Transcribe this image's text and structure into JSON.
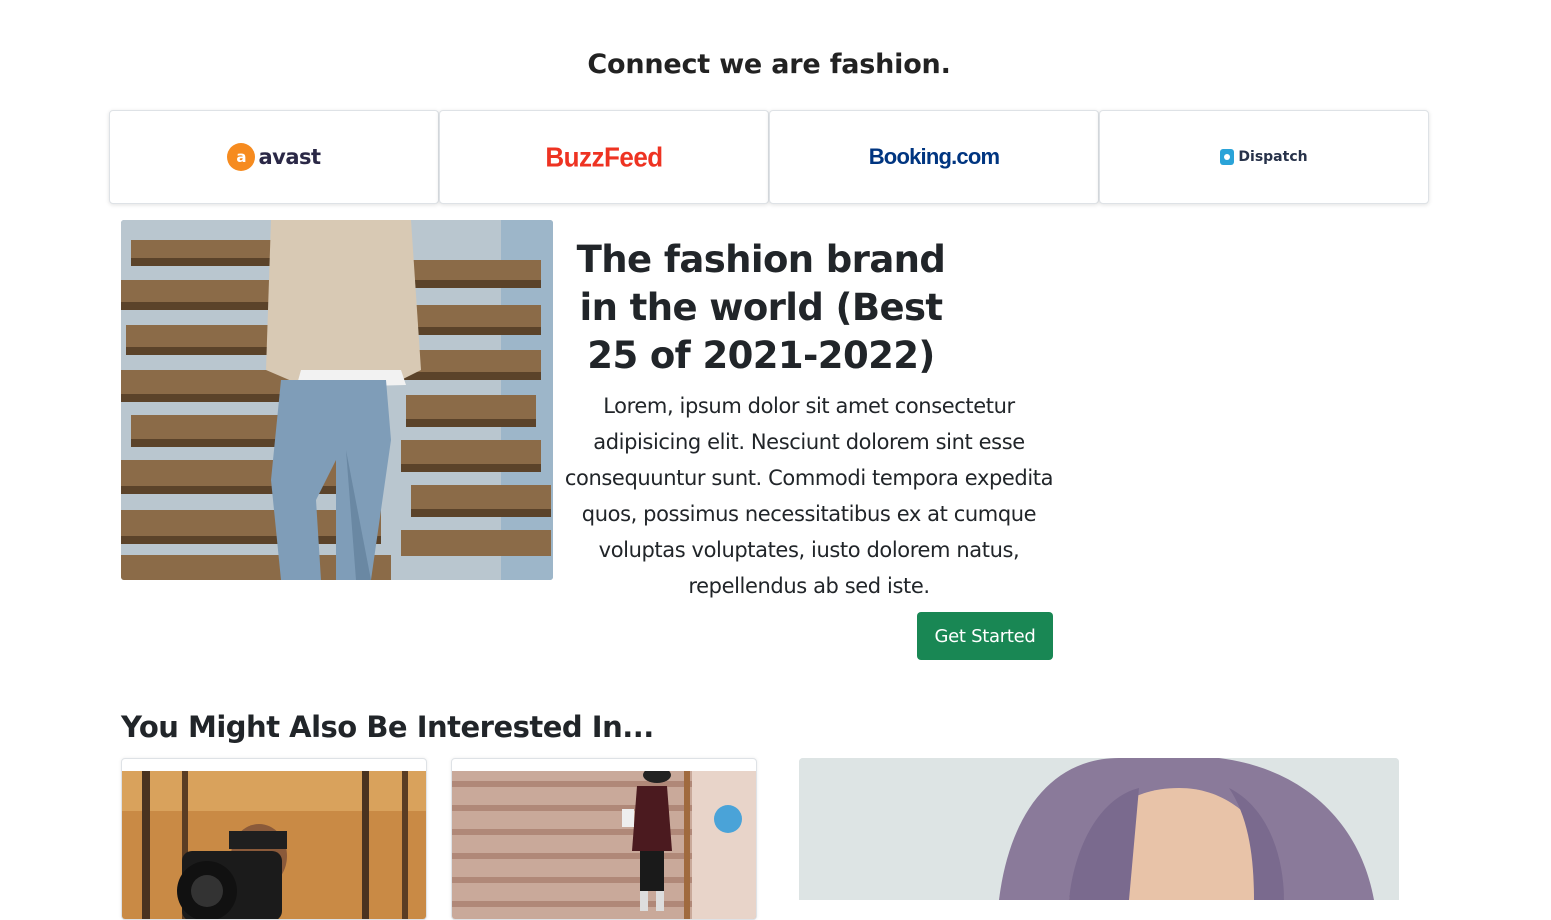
{
  "partners": {
    "heading": "Connect we are fashion.",
    "logos": [
      {
        "name": "avast",
        "mark": "a",
        "color": "#f68b1f"
      },
      {
        "name": "BuzzFeed",
        "color": "#ee3322"
      },
      {
        "name": "Booking.com",
        "color": "#003580"
      },
      {
        "name": "Dispatch",
        "color": "#2aa3d8"
      }
    ]
  },
  "hero": {
    "title": "The fashion brand in the world (Best 25 of 2021-2022)",
    "body": "Lorem, ipsum dolor sit amet consectetur adipisicing elit. Nesciunt dolorem sint esse consequuntur sunt. Commodi tempora expedita quos, possimus necessitatibus ex at cumque voluptas voluptates, iusto dolorem natus, repellendus ab sed iste.",
    "cta_label": "Get Started",
    "cta_color": "#198754"
  },
  "related": {
    "heading": "You Might Also Be Interested In..."
  }
}
